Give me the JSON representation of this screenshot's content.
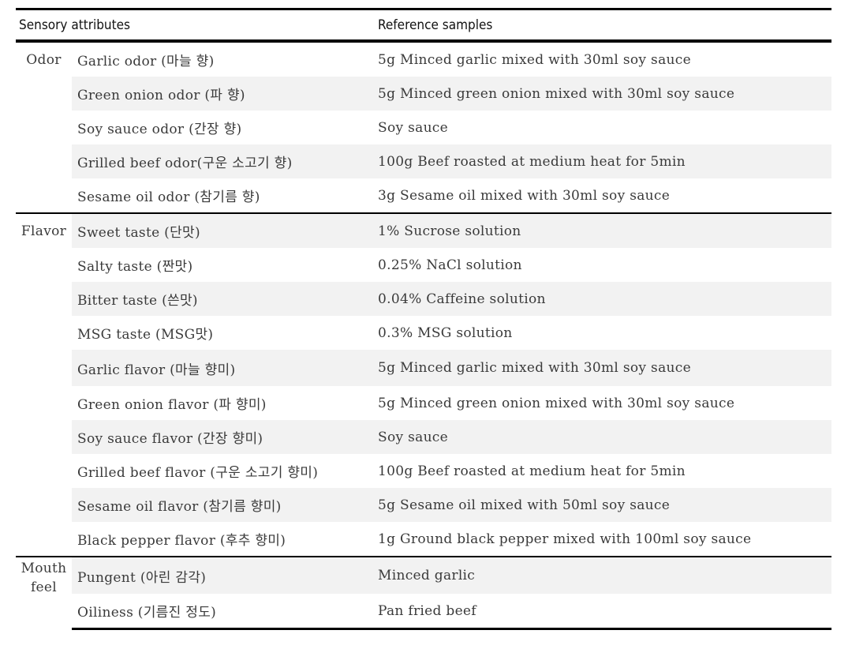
{
  "table": {
    "headers": {
      "sensory_attributes": "Sensory attributes",
      "reference_samples": "Reference samples"
    },
    "sections": [
      {
        "category": "Odor",
        "rows": [
          {
            "attribute": "Garlic odor (마늘 향)",
            "reference": "5g Minced garlic mixed with 30ml soy sauce"
          },
          {
            "attribute": "Green onion odor (파 향)",
            "reference": "5g Minced green onion mixed with 30ml soy sauce"
          },
          {
            "attribute": "Soy sauce odor (간장 향)",
            "reference": "Soy sauce"
          },
          {
            "attribute": "Grilled beef odor(구운 소고기 향)",
            "reference": "100g Beef roasted at medium heat for 5min"
          },
          {
            "attribute": "Sesame oil odor (참기름 향)",
            "reference": "3g Sesame oil mixed with 30ml soy sauce"
          }
        ]
      },
      {
        "category": "Flavor",
        "rows": [
          {
            "attribute": "Sweet taste (단맛)",
            "reference": "1% Sucrose solution"
          },
          {
            "attribute": "Salty taste (짠맛)",
            "reference": "0.25% NaCl solution"
          },
          {
            "attribute": "Bitter taste (쓴맛)",
            "reference": "0.04% Caffeine solution"
          },
          {
            "attribute": "MSG taste (MSG맛)",
            "reference": "0.3% MSG solution"
          },
          {
            "attribute": "Garlic flavor (마늘 향미)",
            "reference": "5g Minced garlic mixed with 30ml soy sauce"
          },
          {
            "attribute": "Green onion flavor (파 향미)",
            "reference": "5g Minced green onion mixed with 30ml soy sauce"
          },
          {
            "attribute": "Soy sauce flavor (간장 향미)",
            "reference": "Soy sauce"
          },
          {
            "attribute": "Grilled beef flavor (구운 소고기 향미)",
            "reference": "100g Beef roasted at medium heat for 5min"
          },
          {
            "attribute": "Sesame oil flavor (참기름 향미)",
            "reference": "5g Sesame oil mixed with 50ml soy sauce"
          },
          {
            "attribute": "Black pepper flavor (후추 향미)",
            "reference": "1g Ground black pepper mixed with 100ml soy sauce"
          }
        ]
      },
      {
        "category_lines": [
          "Mouth",
          "feel"
        ],
        "category": "Mouth feel",
        "rows": [
          {
            "attribute": "Pungent (아린 감각)",
            "reference": "Minced garlic"
          },
          {
            "attribute": "Oiliness (기름진 정도)",
            "reference": "Pan fried beef"
          }
        ]
      }
    ]
  },
  "colors": {
    "row_shade": "#f2f2f2",
    "rule": "#000000",
    "text": "#3a3a3a"
  }
}
